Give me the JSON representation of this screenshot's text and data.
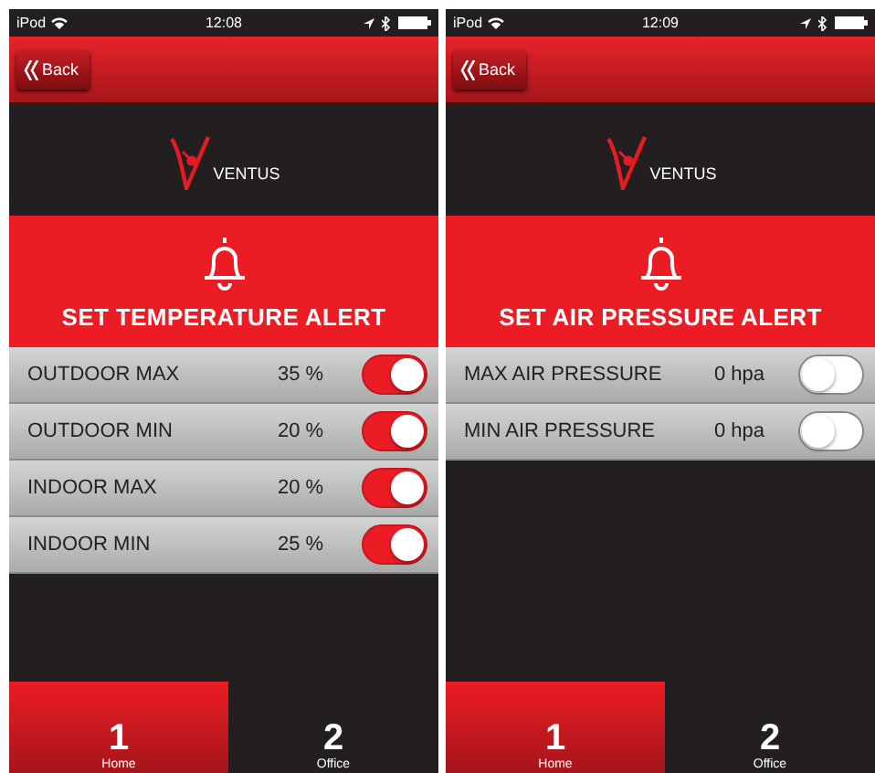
{
  "phones": [
    {
      "status_bar": {
        "carrier": "iPod",
        "time": "12:08"
      },
      "back_button": "Back",
      "logo_text": "VENTUS",
      "title": "SET TEMPERATURE ALERT",
      "alerts": [
        {
          "label": "OUTDOOR MAX",
          "value": "35 %",
          "on": true
        },
        {
          "label": "OUTDOOR MIN",
          "value": "20 %",
          "on": true
        },
        {
          "label": "INDOOR MAX",
          "value": "20 %",
          "on": true
        },
        {
          "label": "INDOOR MIN",
          "value": "25 %",
          "on": true
        }
      ],
      "tabs": [
        {
          "number": "1",
          "label": "Home",
          "selected": true
        },
        {
          "number": "2",
          "label": "Office",
          "selected": false
        }
      ]
    },
    {
      "status_bar": {
        "carrier": "iPod",
        "time": "12:09"
      },
      "back_button": "Back",
      "logo_text": "VENTUS",
      "title": "SET AIR PRESSURE ALERT",
      "alerts": [
        {
          "label": "MAX AIR PRESSURE",
          "value": "0 hpa",
          "on": false
        },
        {
          "label": "MIN AIR PRESSURE",
          "value": "0 hpa",
          "on": false
        }
      ],
      "tabs": [
        {
          "number": "1",
          "label": "Home",
          "selected": true
        },
        {
          "number": "2",
          "label": "Office",
          "selected": false
        }
      ]
    }
  ]
}
